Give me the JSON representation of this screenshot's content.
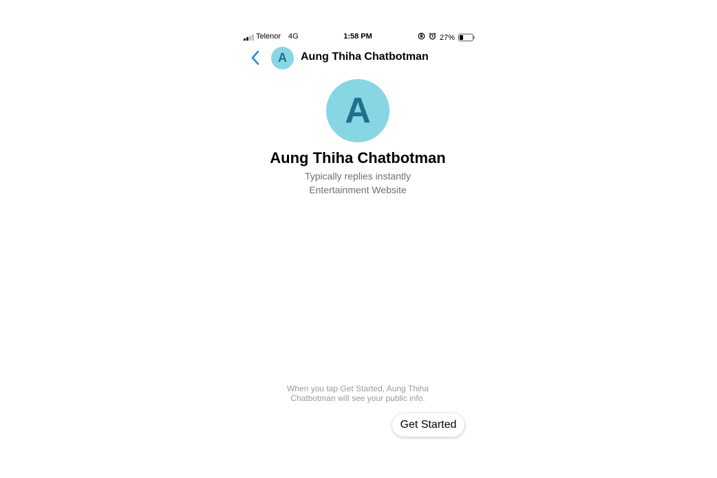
{
  "status_bar": {
    "carrier": "Telenor",
    "network": "4G",
    "time": "1:58 PM",
    "battery_percent": "27%",
    "battery_level": 0.27,
    "signal_bars_filled": 2,
    "signal_bars_total": 4,
    "icons": [
      "orientation-lock-icon",
      "alarm-icon",
      "battery-icon"
    ]
  },
  "header": {
    "back_icon": "chevron-left-icon",
    "avatar_letter": "A",
    "title": "Aung Thiha Chatbotman"
  },
  "profile": {
    "avatar_letter": "A",
    "name": "Aung Thiha Chatbotman",
    "response_time": "Typically replies instantly",
    "category": "Entertainment Website"
  },
  "footer": {
    "disclaimer": "When you tap Get Started, Aung Thiha Chatbotman will see your public info.",
    "get_started_label": "Get Started"
  },
  "colors": {
    "accent": "#1a8cf0",
    "avatar_bg": "#86d6e4",
    "avatar_letter": "#1f6f8f",
    "muted_text": "#6f6f6f"
  }
}
